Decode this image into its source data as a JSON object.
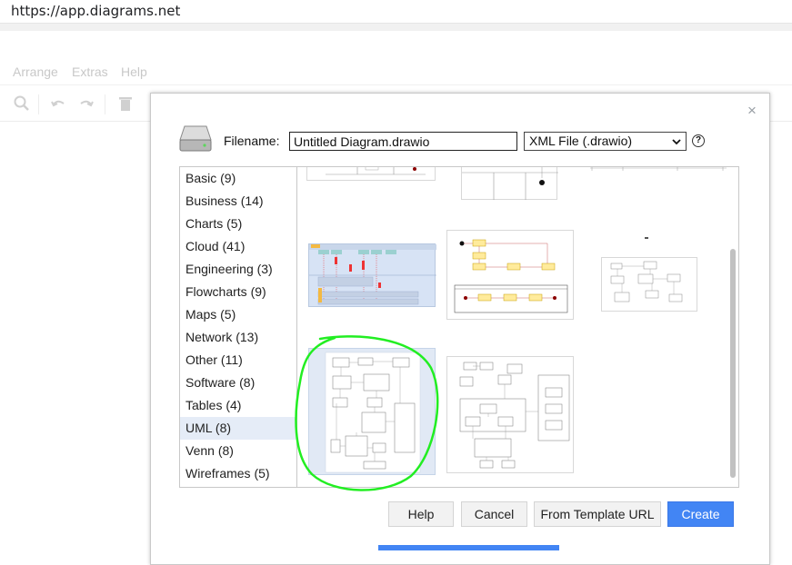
{
  "browser": {
    "url": "https://app.diagrams.net"
  },
  "menu": {
    "items": [
      "Arrange",
      "Extras",
      "Help"
    ]
  },
  "toolbar": {
    "icons": [
      "search-icon",
      "undo-icon",
      "redo-icon",
      "delete-icon"
    ]
  },
  "dialog": {
    "filename_label": "Filename:",
    "filename_value": "Untitled Diagram.drawio",
    "format_value": "XML File (.drawio)",
    "help_glyph": "?",
    "close_glyph": "×",
    "categories": [
      {
        "label": "Basic (9)"
      },
      {
        "label": "Business (14)"
      },
      {
        "label": "Charts (5)"
      },
      {
        "label": "Cloud (41)"
      },
      {
        "label": "Engineering (3)"
      },
      {
        "label": "Flowcharts (9)"
      },
      {
        "label": "Maps (5)"
      },
      {
        "label": "Network (13)"
      },
      {
        "label": "Other (11)"
      },
      {
        "label": "Software (8)"
      },
      {
        "label": "Tables (4)"
      },
      {
        "label": "UML (8)"
      },
      {
        "label": "Venn (8)"
      },
      {
        "label": "Wireframes (5)"
      }
    ],
    "selected_category": "UML (8)",
    "buttons": {
      "help": "Help",
      "cancel": "Cancel",
      "from_template_url": "From Template URL",
      "create": "Create"
    },
    "colors": {
      "primary": "#4285f4",
      "selection": "#e5ecf7",
      "annotation": "#22ee22"
    }
  }
}
